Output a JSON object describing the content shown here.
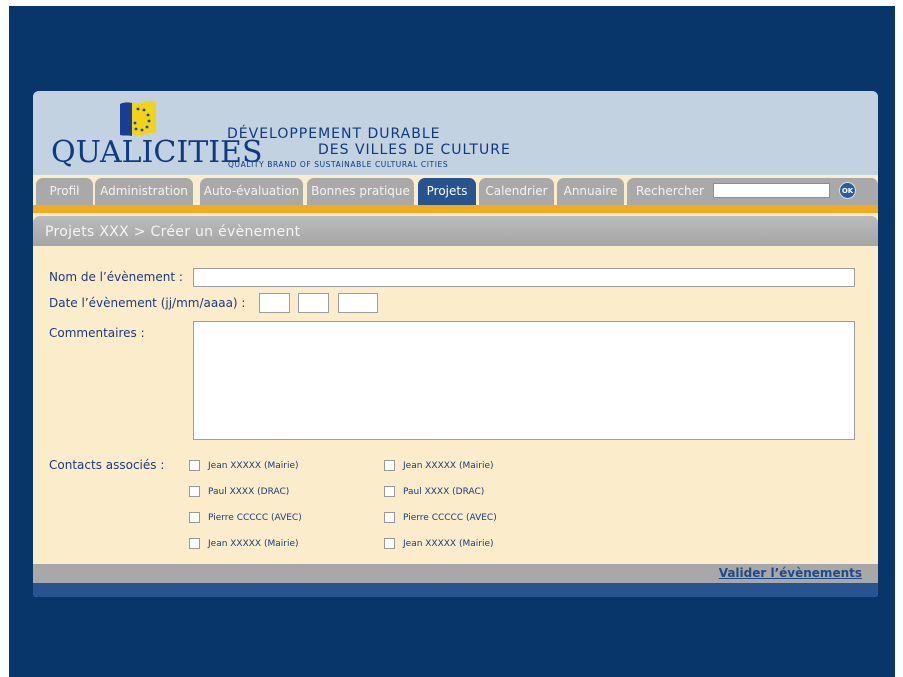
{
  "brand": {
    "name": "QUALICITIES",
    "tagline_line1": "DÉVELOPPEMENT DURABLE",
    "tagline_line2": "DES VILLES DE CULTURE",
    "tagline_line3": "QUALITY BRAND OF SUSTAINABLE CULTURAL CITIES",
    "flag_color": "#f2d31b",
    "flag_stars": "#1a3d94"
  },
  "nav": {
    "tabs": [
      {
        "label": "Profil",
        "active": false
      },
      {
        "label": "Administration",
        "active": false
      },
      {
        "label": "Auto-évaluation",
        "active": false
      },
      {
        "label": "Bonnes pratique",
        "active": false
      },
      {
        "label": "Projets",
        "active": true
      },
      {
        "label": "Calendrier",
        "active": false
      },
      {
        "label": "Annuaire",
        "active": false
      },
      {
        "label": "Rechercher",
        "active": false
      }
    ],
    "search_value": "",
    "ok_label": "OK"
  },
  "page": {
    "breadcrumb": "Projets XXX > Créer un évènement"
  },
  "form": {
    "name_label": "Nom de l’évènement :",
    "name_value": "",
    "date_label": "Date l’évènement (jj/mm/aaaa) :",
    "date_day": "",
    "date_month": "",
    "date_year": "",
    "comments_label": "Commentaires :",
    "comments_value": "",
    "contacts_label": "Contacts associés :",
    "contacts_col1": [
      {
        "label": "Jean XXXXX (Mairie)",
        "checked": false
      },
      {
        "label": "Paul XXXX (DRAC)",
        "checked": false
      },
      {
        "label": "Pierre CCCCC (AVEC)",
        "checked": false
      },
      {
        "label": "Jean XXXXX (Mairie)",
        "checked": false
      }
    ],
    "contacts_col2": [
      {
        "label": "Jean XXXXX (Mairie)",
        "checked": false
      },
      {
        "label": "Paul XXXX (DRAC)",
        "checked": false
      },
      {
        "label": "Pierre CCCCC (AVEC)",
        "checked": false
      },
      {
        "label": "Jean XXXXX (Mairie)",
        "checked": false
      }
    ],
    "submit_label": "Valider l’évènements"
  },
  "colors": {
    "slide_bg": "#08356a",
    "header_bg": "#c2d2e0",
    "tab_active": "#27548e",
    "tab_inactive": "#a9a9a9",
    "accent_orange": "#f2ab1f",
    "form_bg": "#fbeccc",
    "label_text": "#1d3b7a"
  }
}
